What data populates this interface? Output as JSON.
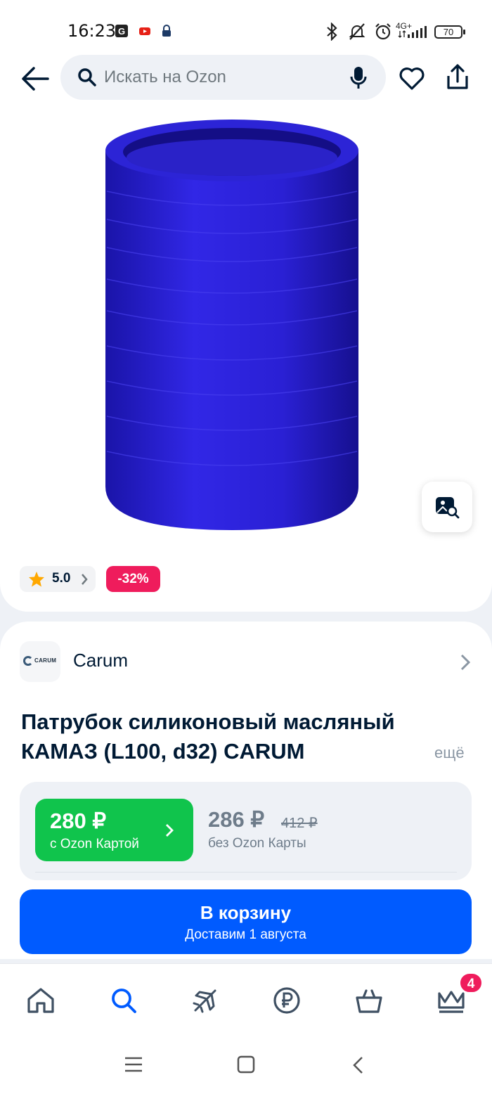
{
  "status_bar": {
    "time": "16:23",
    "network": "4G+",
    "battery": "70"
  },
  "header": {
    "search_placeholder": "Искать на Ozon"
  },
  "product": {
    "rating": "5.0",
    "discount": "-32%",
    "brand": "Carum",
    "brand_logo_text": "CARUM",
    "title": "Патрубок силиконовый масляный КАМАЗ (L100, d32) CARUM",
    "more_label": "ещё",
    "image_color": "#2a22d6"
  },
  "prices": {
    "card_price": "280 ₽",
    "card_label": "с Ozon Картой",
    "regular_price": "286 ₽",
    "old_price": "412 ₽",
    "regular_label": "без Ozon Карты"
  },
  "cart_button": {
    "label": "В корзину",
    "delivery": "Доставим 1 августа"
  },
  "bottom_nav": {
    "items": [
      "home-icon",
      "search-icon",
      "plane-icon",
      "ruble-icon",
      "basket-icon",
      "crown-icon"
    ],
    "badge": "4",
    "active_color": "#005bff"
  },
  "colors": {
    "accent": "#005bff",
    "green": "#10c44c",
    "discount": "#ef1c5c"
  }
}
